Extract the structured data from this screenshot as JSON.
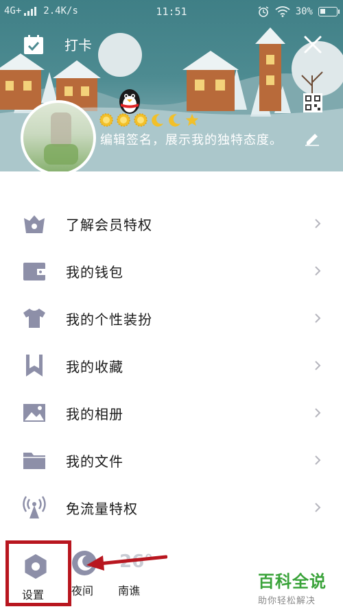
{
  "status_bar": {
    "network": "4G+",
    "speed": "2.4K/s",
    "time": "11:51",
    "battery": "30%",
    "battery_level": 0.3,
    "icons": [
      "alarm-icon",
      "wifi-icon",
      "battery-icon"
    ]
  },
  "header": {
    "checkin_label": "打卡",
    "close_icon": "close-icon",
    "signature": "编辑签名，展示我的独特态度。",
    "level_icons": [
      "sun",
      "sun",
      "sun",
      "moon",
      "moon",
      "star"
    ]
  },
  "menu": [
    {
      "label": "了解会员特权",
      "icon": "crown-icon"
    },
    {
      "label": "我的钱包",
      "icon": "wallet-icon"
    },
    {
      "label": "我的个性装扮",
      "icon": "tshirt-icon"
    },
    {
      "label": "我的收藏",
      "icon": "bookmark-icon"
    },
    {
      "label": "我的相册",
      "icon": "photo-icon"
    },
    {
      "label": "我的文件",
      "icon": "folder-icon"
    },
    {
      "label": "免流量特权",
      "icon": "antenna-icon"
    }
  ],
  "bottom": {
    "settings_label": "设置",
    "night_label": "夜间",
    "weather_temp": "26°",
    "weather_city": "南谯"
  },
  "watermark": {
    "title": "百科全说",
    "subtitle": "助你轻松解决"
  },
  "colors": {
    "header_bg": "#4d8b91",
    "icon_gray": "#8d8fa8",
    "highlight_red": "#b8161f",
    "watermark_green": "#3aa33a"
  }
}
